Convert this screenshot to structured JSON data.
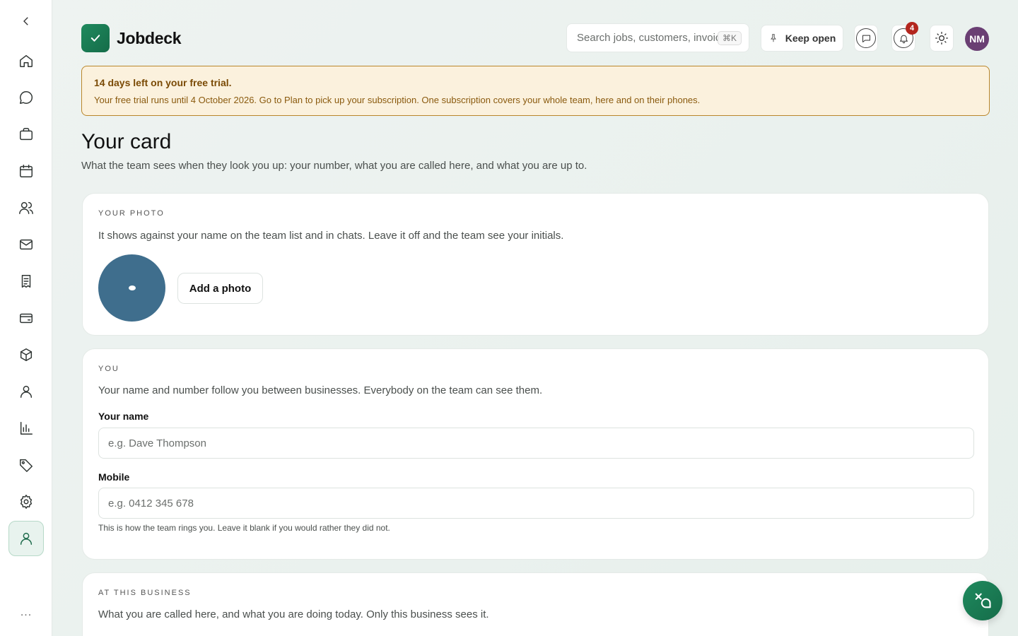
{
  "app": {
    "name": "Jobdeck"
  },
  "header": {
    "search_placeholder": "Search jobs, customers, invoices",
    "search_shortcut": "⌘K",
    "keep_open_label": "Keep open",
    "notifications_count": "4",
    "user_initials": "NM",
    "avatar_color": "#6a3f73"
  },
  "sidebar": {
    "items": [
      {
        "icon": "home-icon"
      },
      {
        "icon": "chat-icon"
      },
      {
        "icon": "briefcase-icon"
      },
      {
        "icon": "calendar-icon"
      },
      {
        "icon": "team-icon"
      },
      {
        "icon": "mail-icon"
      },
      {
        "icon": "receipt-icon"
      },
      {
        "icon": "card-icon"
      },
      {
        "icon": "box-icon"
      },
      {
        "icon": "person-icon"
      },
      {
        "icon": "chart-icon"
      },
      {
        "icon": "tag-icon"
      },
      {
        "icon": "gear-icon"
      },
      {
        "icon": "profile-icon",
        "active": true
      }
    ],
    "more_label": "..."
  },
  "trial_banner": {
    "title": "14 days left on your free trial.",
    "body": "Your free trial runs until 4 October 2026. Go to Plan to pick up your subscription. One subscription covers your whole team, here and on their phones."
  },
  "page": {
    "title": "Your card",
    "subtitle": "What the team sees when they look you up: your number, what you are called here, and what you are up to."
  },
  "photo_card": {
    "label": "YOUR PHOTO",
    "description": "It shows against your name on the team list and in chats. Leave it off and the team see your initials.",
    "add_photo_label": "Add a photo",
    "avatar_color": "#3f6e8d"
  },
  "you_card": {
    "label": "YOU",
    "description": "Your name and number follow you between businesses. Everybody on the team can see them.",
    "name_label": "Your name",
    "name_placeholder": "e.g. Dave Thompson",
    "mobile_label": "Mobile",
    "mobile_placeholder": "e.g. 0412 345 678",
    "mobile_hint": "This is how the team rings you. Leave it blank if you would rather they did not."
  },
  "business_card": {
    "label": "AT THIS BUSINESS",
    "description": "What you are called here, and what you are doing today. Only this business sees it."
  },
  "colors": {
    "brand": "#1a7a52",
    "warning_border": "#b9862b",
    "warning_bg": "#fbf1dd",
    "badge": "#b3261e"
  }
}
